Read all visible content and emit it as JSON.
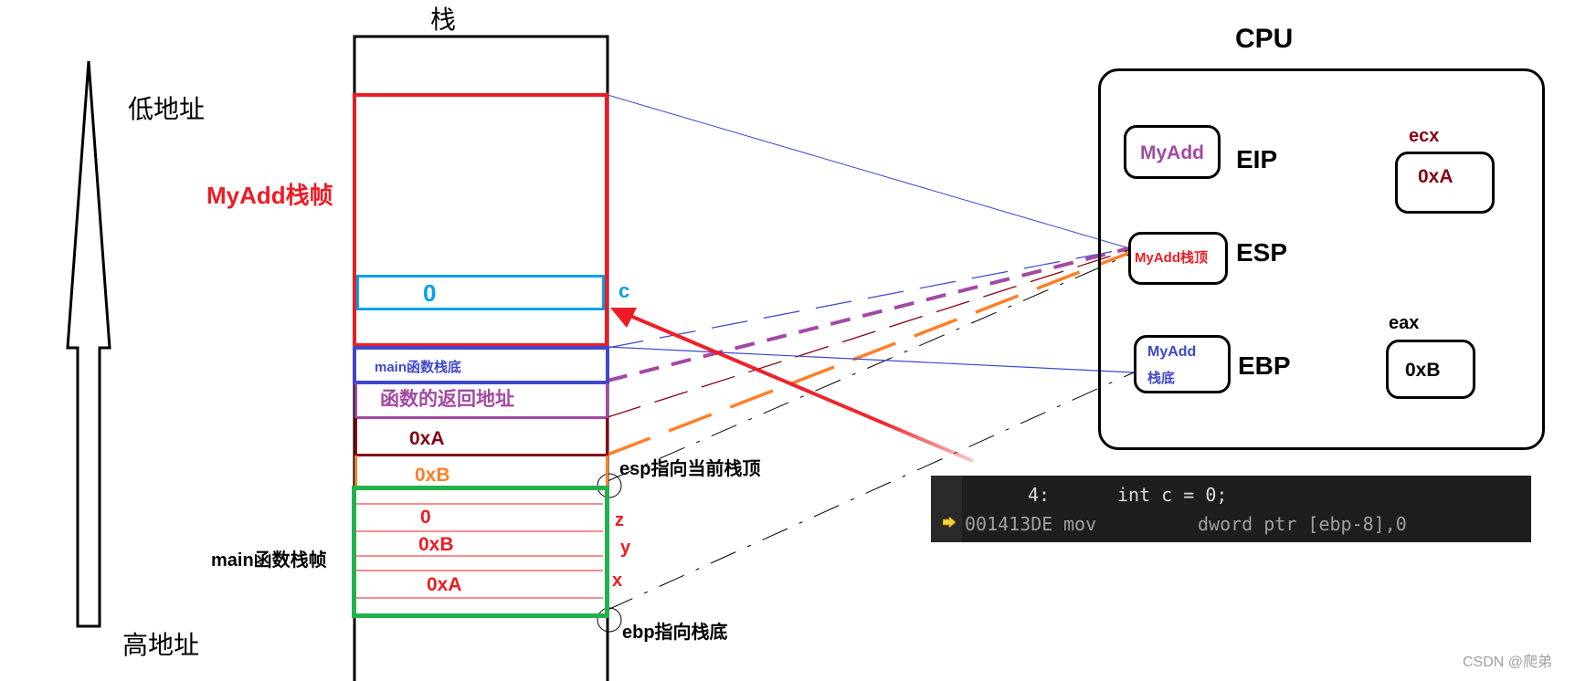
{
  "title": {
    "stack": "栈",
    "cpu": "CPU"
  },
  "address_labels": {
    "low": "低地址",
    "high": "高地址"
  },
  "frame_labels": {
    "myadd": "MyAdd栈帧",
    "main": "main函数栈帧"
  },
  "stack_cells": {
    "c_value": "0",
    "c_label": "c",
    "main_base": "main函数栈底",
    "return_addr": "函数的返回地址",
    "arg_a": "0xA",
    "arg_b": "0xB",
    "z_value": "0",
    "z_label": "z",
    "y_value": "0xB",
    "y_label": "y",
    "x_value": "0xA",
    "x_label": "x"
  },
  "pointer_labels": {
    "esp": "esp指向当前栈顶",
    "ebp": "ebp指向栈底"
  },
  "registers": {
    "eip": {
      "name": "EIP",
      "value": "MyAdd"
    },
    "esp": {
      "name": "ESP",
      "value": "MyAdd栈顶"
    },
    "ebp": {
      "name": "EBP",
      "value_line1": "MyAdd",
      "value_line2": "栈底"
    },
    "ecx": {
      "name": "ecx",
      "value": "0xA"
    },
    "eax": {
      "name": "eax",
      "value": "0xB"
    }
  },
  "code": {
    "source_line_no": "4:",
    "source_text": "int c = 0;",
    "address": "001413DE",
    "mnemonic": "mov",
    "operands": "dword ptr [ebp-8],0",
    "current_line_icon": "instruction-pointer-arrow"
  },
  "colors": {
    "red": "#ed1c24",
    "cyan": "#00a2e8",
    "blue": "#3f48cc",
    "purple": "#a349a4",
    "darkred": "#880015",
    "orange": "#ff7f27",
    "green": "#22b14c"
  },
  "watermark": "CSDN @爬弟"
}
